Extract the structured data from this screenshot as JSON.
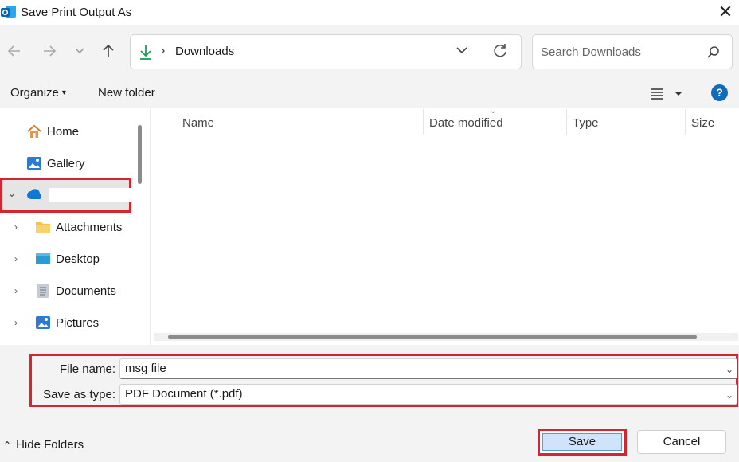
{
  "window": {
    "title": "Save Print Output As",
    "close_glyph": "✕",
    "app_icon": "outlook-icon"
  },
  "navbar": {
    "back_icon": "arrow-left-icon",
    "forward_icon": "arrow-right-icon",
    "recent_icon": "chevron-down-icon",
    "up_icon": "arrow-up-icon",
    "path_separator": "›",
    "address": "Downloads",
    "refresh_icon": "refresh-icon",
    "search_placeholder": "Search Downloads"
  },
  "toolbar": {
    "organize_label": "Organize",
    "caret": "▾",
    "new_folder_label": "New folder",
    "view_icon": "list-view-icon",
    "help_label": "?"
  },
  "sidebar": {
    "items": [
      {
        "label": "Home",
        "icon": "home-icon"
      },
      {
        "label": "Gallery",
        "icon": "gallery-icon"
      },
      {
        "label": "",
        "icon": "onedrive-cloud-icon",
        "expanded": true
      },
      {
        "label": "Attachments",
        "icon": "folder-icon"
      },
      {
        "label": "Desktop",
        "icon": "desktop-icon"
      },
      {
        "label": "Documents",
        "icon": "documents-icon"
      },
      {
        "label": "Pictures",
        "icon": "pictures-icon"
      }
    ],
    "expanded_glyph": "⌄",
    "collapsed_glyph": "›"
  },
  "file_list": {
    "columns": [
      "Name",
      "Date modified",
      "Type",
      "Size"
    ],
    "rows": []
  },
  "form": {
    "file_name_label": "File name:",
    "file_name_value": "msg file",
    "save_as_type_label": "Save as type:",
    "save_as_type_value": "PDF Document (*.pdf)",
    "dropdown_glyph": "⌄"
  },
  "footer": {
    "hide_folders_label": "Hide Folders",
    "hide_folders_glyph": "⌃",
    "save_label": "Save",
    "cancel_label": "Cancel"
  },
  "colors": {
    "highlight_border": "#d32630",
    "accent": "#0f6cbd",
    "primary_button": "#cfe4fa",
    "chrome_bg": "#f3f3f3"
  }
}
